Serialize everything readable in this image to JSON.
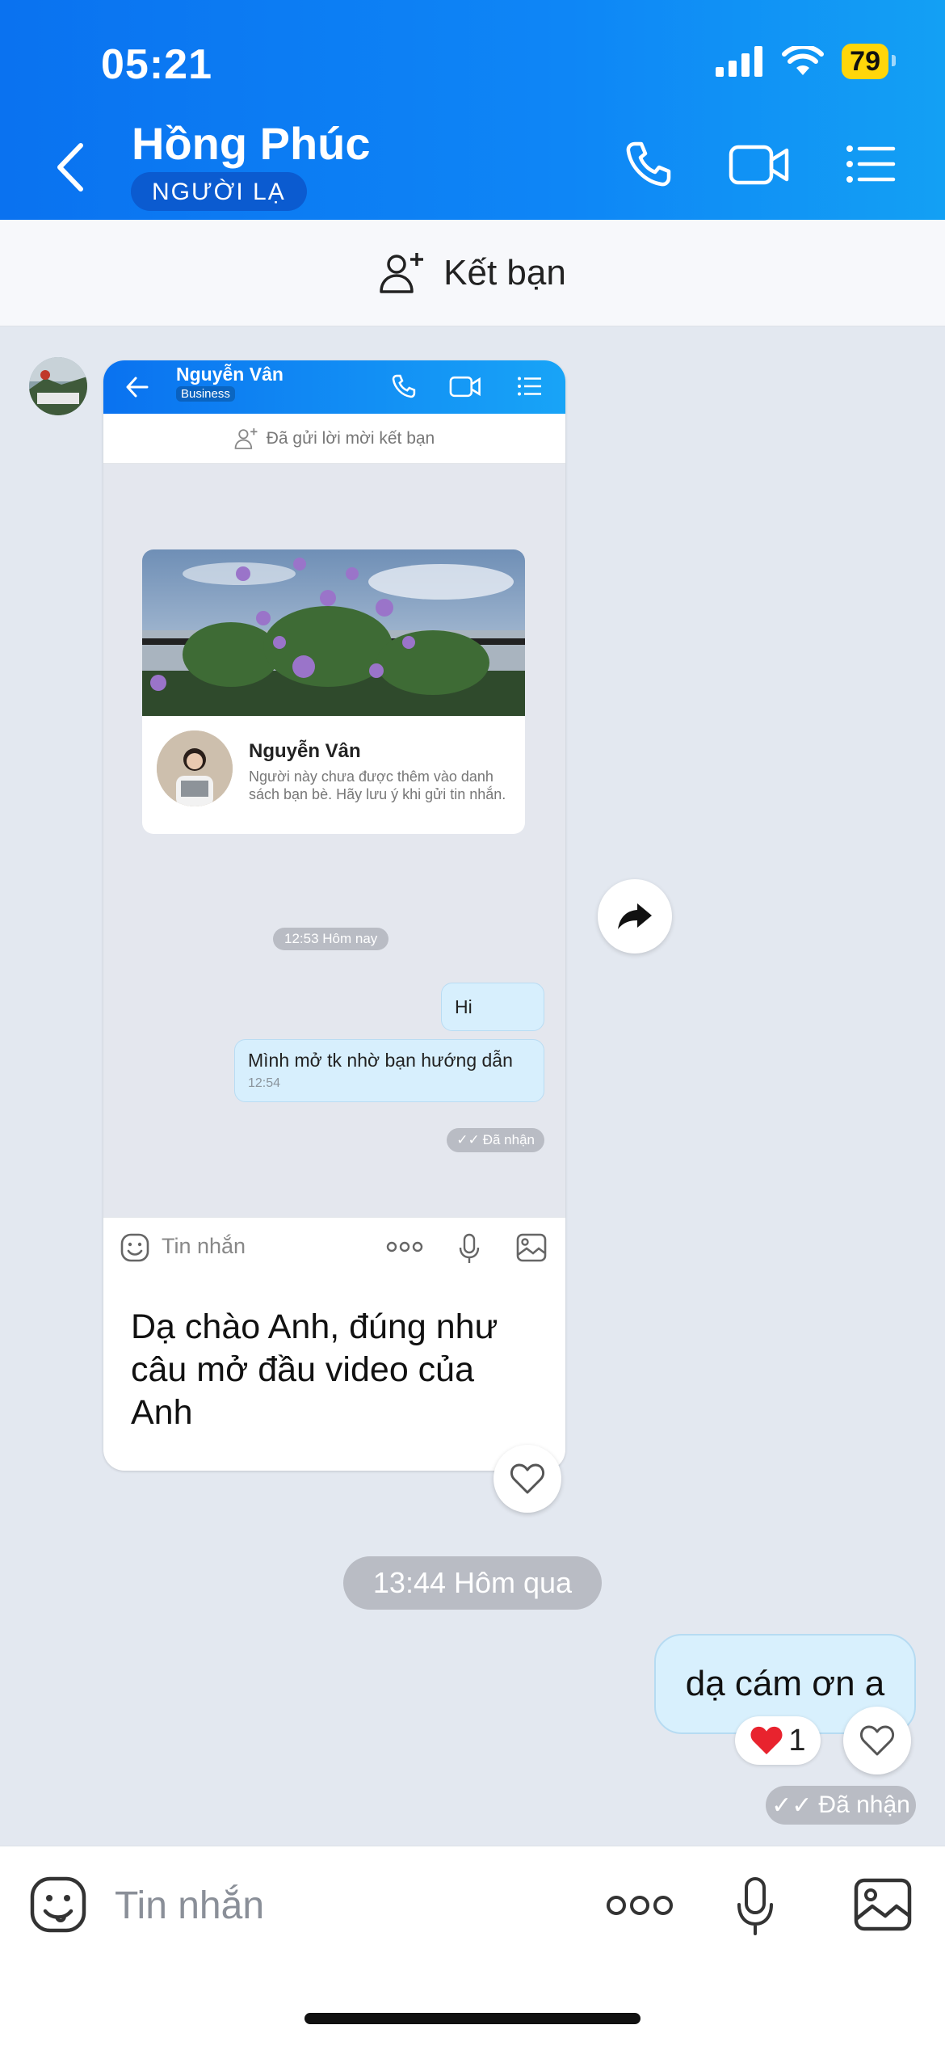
{
  "status_bar": {
    "time": "05:21",
    "battery": "79"
  },
  "header": {
    "contact_name": "Hồng Phúc",
    "badge": "NGƯỜI LẠ"
  },
  "add_friend": {
    "label": "Kết bạn"
  },
  "shared_card": {
    "mini_header": {
      "name": "Nguyễn Vân",
      "badge": "Business"
    },
    "mini_request_sent": "Đã gửi lời mời kết bạn",
    "profile": {
      "name": "Nguyễn Vân",
      "description": "Người này chưa được thêm vào danh sách bạn bè. Hãy lưu ý khi gửi tin nhắn."
    },
    "mini_time": "12:53 Hôm nay",
    "mini_messages": [
      {
        "text": "Hi"
      },
      {
        "text": "Mình mở tk nhờ bạn hướng dẫn",
        "time": "12:54"
      }
    ],
    "mini_received": "Đã nhận",
    "mini_input_placeholder": "Tin nhắn",
    "caption": "Dạ chào Anh, đúng như câu mở đầu video của Anh"
  },
  "time_divider": "13:44 Hôm qua",
  "my_message": {
    "text": "dạ cám ơn a",
    "reaction_count": "1"
  },
  "received_label": "Đã nhận",
  "input": {
    "placeholder": "Tin nhắn"
  },
  "colors": {
    "header_blue": "#0a72f0",
    "bubble_blue": "#d8f0fd",
    "pill_gray": "#b9bcc4"
  }
}
